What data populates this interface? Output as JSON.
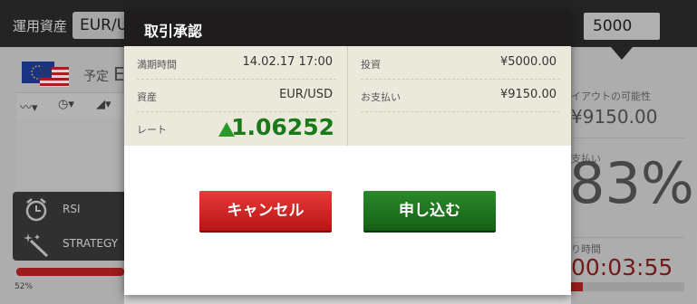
{
  "topbar": {
    "asset_label": "運用資産",
    "asset_value": "EUR/U",
    "amount_value": "5000"
  },
  "background": {
    "yotei": "予定",
    "yotei_e": "E",
    "tools": [
      {
        "label": "RSI",
        "icon": "clock-icon"
      },
      {
        "label": "STRATEGY",
        "icon": "magic-wand-icon"
      }
    ],
    "progress_pct_label": "52%",
    "progress": 0.52
  },
  "right_panel": {
    "payout_label": "イアウトの可能性",
    "payout_value": "¥9150.00",
    "pay_label": "支払い",
    "pay_value": "83%",
    "time_label": "り時間",
    "time_value": "00:03:55"
  },
  "modal": {
    "title": "取引承認",
    "left_rows": [
      {
        "label": "満期時間",
        "value": "14.02.17 17:00"
      },
      {
        "label": "資産",
        "value": "EUR/USD"
      },
      {
        "label": "レート",
        "value": "1.06252"
      }
    ],
    "right_rows": [
      {
        "label": "投資",
        "value": "¥5000.00"
      },
      {
        "label": "お支払い",
        "value": "¥9150.00"
      }
    ],
    "rate_direction": "up",
    "cancel_label": "キャンセル",
    "apply_label": "申し込む"
  },
  "colors": {
    "header_bg": "#1e1c1c",
    "info_bg": "#ebe8dc",
    "rate_green": "#1a7a1a",
    "cancel_red": "#d82a2a",
    "apply_green": "#1f741f"
  }
}
